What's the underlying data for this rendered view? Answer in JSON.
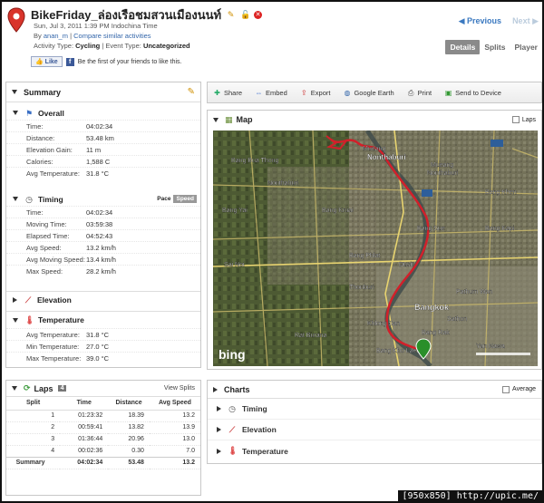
{
  "header": {
    "title": "BikeFriday_ล่องเรือชมสวนเมืองนนท์",
    "datetime": "Sun, Jul 3, 2011 1:39 PM Indochina Time",
    "by_prefix": "By",
    "user": "anan_m",
    "separator": "|",
    "compare_link": "Compare similar activities",
    "activity_type_label": "Activity Type:",
    "activity_type": "Cycling",
    "event_type_label": "| Event Type:",
    "event_type": "Uncategorized",
    "prev_label": "◀ Previous",
    "next_label": "Next ▶",
    "views": [
      "Details",
      "Splits",
      "Player"
    ],
    "like_label": "Like",
    "like_text": "Be the first of your friends to like this."
  },
  "summary": {
    "title": "Summary",
    "overall": {
      "title": "Overall",
      "rows": [
        {
          "k": "Time:",
          "v": "04:02:34"
        },
        {
          "k": "Distance:",
          "v": "53.48 km"
        },
        {
          "k": "Elevation Gain:",
          "v": "11 m"
        },
        {
          "k": "Calories:",
          "v": "1,588 C"
        },
        {
          "k": "Avg Temperature:",
          "v": "31.8 °C"
        }
      ]
    },
    "timing": {
      "title": "Timing",
      "toggle": [
        "Pace",
        "Speed"
      ],
      "rows": [
        {
          "k": "Time:",
          "v": "04:02:34"
        },
        {
          "k": "Moving Time:",
          "v": "03:59:38"
        },
        {
          "k": "Elapsed Time:",
          "v": "04:52:43"
        },
        {
          "k": "Avg Speed:",
          "v": "13.2 km/h"
        },
        {
          "k": "Avg Moving Speed:",
          "v": "13.4 km/h"
        },
        {
          "k": "Max Speed:",
          "v": "28.2 km/h"
        }
      ]
    },
    "elevation": {
      "title": "Elevation"
    },
    "temperature": {
      "title": "Temperature",
      "rows": [
        {
          "k": "Avg Temperature:",
          "v": "31.8 °C"
        },
        {
          "k": "Min Temperature:",
          "v": "27.0 °C"
        },
        {
          "k": "Max Temperature:",
          "v": "39.0 °C"
        }
      ]
    }
  },
  "laps": {
    "title": "Laps",
    "count": "4",
    "view_splits": "View Splits",
    "columns": [
      "Split",
      "Time",
      "Distance",
      "Avg Speed"
    ],
    "rows": [
      [
        "1",
        "01:23:32",
        "18.39",
        "13.2"
      ],
      [
        "2",
        "00:59:41",
        "13.82",
        "13.9"
      ],
      [
        "3",
        "01:36:44",
        "20.96",
        "13.0"
      ],
      [
        "4",
        "00:02:36",
        "0.30",
        "7.0"
      ]
    ],
    "summary_row": [
      "Summary",
      "04:02:34",
      "53.48",
      "13.2"
    ]
  },
  "toolbar": [
    "Share",
    "Embed",
    "Export",
    "Google Earth",
    "Print",
    "Send to Device"
  ],
  "map": {
    "title": "Map",
    "laps_label": "Laps",
    "labels": [
      "Mueang",
      "Nonthaburi",
      "Mueang",
      "Nonthaburi",
      "Bang Kruai",
      "Bang Kapi",
      "Bang Khen",
      "Bangkok",
      "Bang Sue",
      "Bang Phlat",
      "Dusit",
      "Thonburi",
      "Bang Rak",
      "Pathum Wan",
      "Yan Nawa",
      "Sathon",
      "Khlong San",
      "Bang Kho Laem",
      "Nonthaburi",
      "Bang Bua Thong",
      "Bang Yai",
      "Sai Noi",
      "Rat Burana"
    ],
    "logo": "bing"
  },
  "charts": {
    "title": "Charts",
    "average_label": "Average",
    "items": [
      "Timing",
      "Elevation",
      "Temperature"
    ]
  },
  "footer": "[950x850] http://upic.me/"
}
